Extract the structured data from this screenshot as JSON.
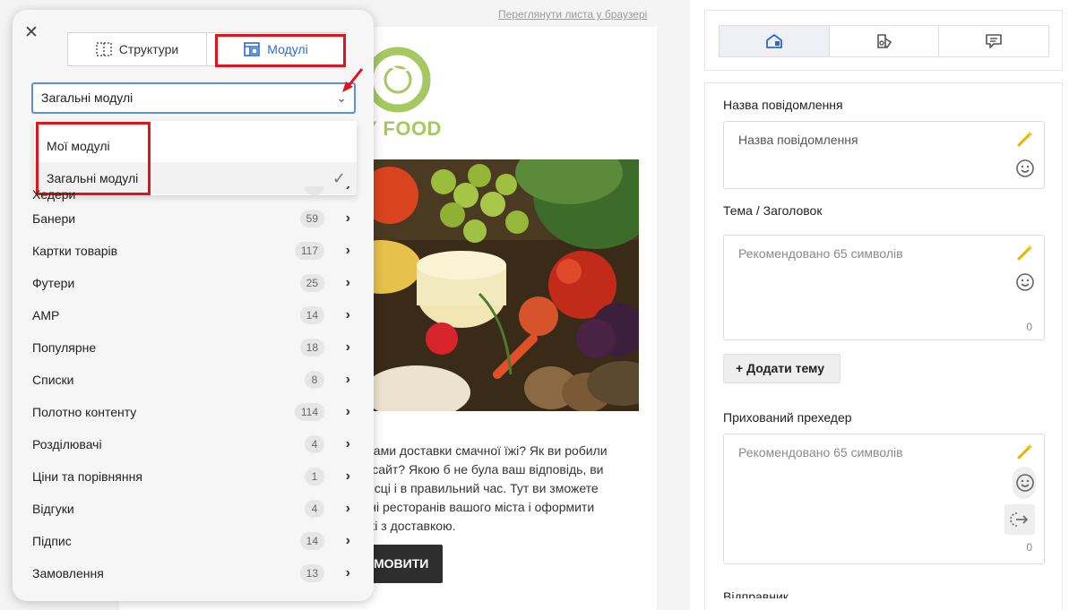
{
  "email": {
    "browser_link": "Переглянути листа у браузері",
    "logo_text": "Y FOOD",
    "body_text": "угами доставки смачної їжі? Як ви робили\nз сайт? Якою б не була ваш відповідь, ви\nмісці і в правильний час. Тут ви зможете\nчні ресторанів вашого міста і оформити\n їжі з доставкою.",
    "button_label": "МОВИТИ"
  },
  "panel": {
    "tabs": [
      {
        "label": "Структури",
        "icon": "structure-icon",
        "active": false
      },
      {
        "label": "Модулі",
        "icon": "modules-icon",
        "active": true
      }
    ],
    "select_value": "Загальні модулі",
    "dropdown": {
      "options": [
        {
          "label": "Мої модулі",
          "selected": false
        },
        {
          "label": "Загальні модулі",
          "selected": true
        }
      ]
    },
    "categories": [
      {
        "label": "Хедери",
        "count": "",
        "partial": true
      },
      {
        "label": "Банери",
        "count": "59"
      },
      {
        "label": "Картки товарів",
        "count": "117"
      },
      {
        "label": "Футери",
        "count": "25"
      },
      {
        "label": "AMP",
        "count": "14"
      },
      {
        "label": "Популярне",
        "count": "18"
      },
      {
        "label": "Списки",
        "count": "8"
      },
      {
        "label": "Полотно контенту",
        "count": "114"
      },
      {
        "label": "Розділювачі",
        "count": "4"
      },
      {
        "label": "Ціни та порівняння",
        "count": "1"
      },
      {
        "label": "Відгуки",
        "count": "4"
      },
      {
        "label": "Підпис",
        "count": "14"
      },
      {
        "label": "Замовлення",
        "count": "13"
      }
    ]
  },
  "settings": {
    "tabs": [
      {
        "icon": "message-settings-icon",
        "active": true
      },
      {
        "icon": "tags-icon",
        "active": false
      },
      {
        "icon": "comment-icon",
        "active": false
      }
    ],
    "message_name": {
      "label": "Назва повідомлення",
      "placeholder": "Назва повідомлення"
    },
    "subject": {
      "label": "Тема / Заголовок",
      "placeholder": "Рекомендовано 65 символів",
      "counter": "0"
    },
    "add_topic_label": "+ Додати тему",
    "preheader": {
      "label": "Прихований прехедер",
      "placeholder": "Рекомендовано 65 символів",
      "counter": "0"
    },
    "bottom_label": "Відправник"
  },
  "colors": {
    "highlight_red": "#e3131b",
    "active_blue": "#2c6ac7",
    "logo_green": "#a5c960"
  }
}
